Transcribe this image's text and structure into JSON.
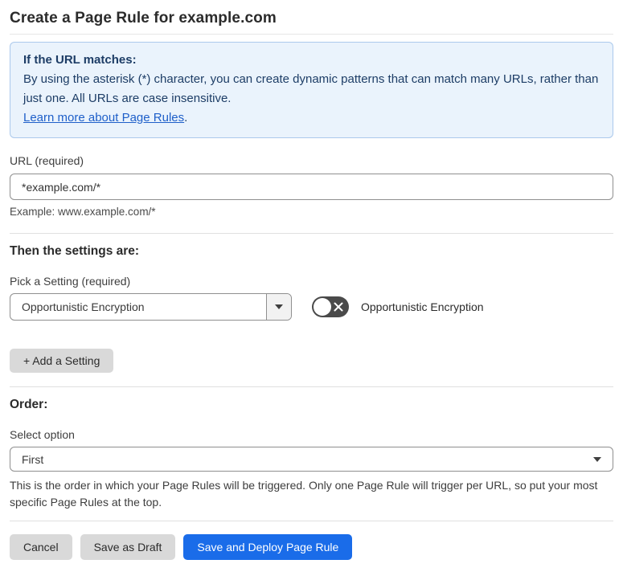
{
  "page": {
    "title": "Create a Page Rule for example.com"
  },
  "info_box": {
    "heading": "If the URL matches:",
    "body": "By using the asterisk (*) character, you can create dynamic patterns that can match many URLs, rather than just one. All URLs are case insensitive.",
    "link_label": "Learn more about Page Rules",
    "link_suffix": "."
  },
  "url_field": {
    "label": "URL (required)",
    "value": "*example.com/*",
    "helper": "Example: www.example.com/*"
  },
  "settings_section": {
    "heading": "Then the settings are:",
    "picker_label": "Pick a Setting (required)",
    "selected_setting": "Opportunistic Encryption",
    "toggle_state": "off",
    "toggle_label": "Opportunistic Encryption",
    "add_setting_label": "+ Add a Setting"
  },
  "order_section": {
    "heading": "Order:",
    "select_label": "Select option",
    "selected_option": "First",
    "help": "This is the order in which your Page Rules will be triggered. Only one Page Rule will trigger per URL, so put your most specific Page Rules at the top."
  },
  "footer": {
    "cancel_label": "Cancel",
    "save_draft_label": "Save as Draft",
    "save_deploy_label": "Save and Deploy Page Rule"
  },
  "colors": {
    "primary_blue": "#1a6ce9",
    "link_blue": "#1e5fc9",
    "info_text_navy": "#1d3d66",
    "info_bg": "#eaf3fc",
    "info_border": "#abc9ec",
    "toggle_off_bg": "#4a4a4a",
    "gray_button_bg": "#d9d9d9",
    "input_border": "#8f8f8f"
  }
}
